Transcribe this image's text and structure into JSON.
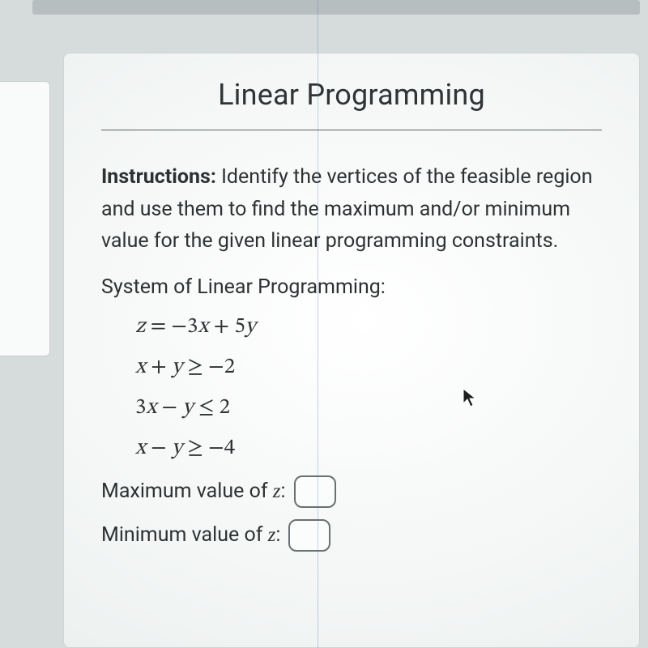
{
  "title": "Linear Programming",
  "instructions_label": "Instructions:",
  "instructions_text": " Identify the vertices of the feasible region and use them to find the maximum and/or minimum value for the given linear programming constraints.",
  "system_label": "System of Linear Programming:",
  "equations": {
    "objective": "z = −3x + 5y",
    "c1": "x + y ≥ −2",
    "c2": "3x − y ≤ 2",
    "c3": "x − y ≥ −4"
  },
  "answers": {
    "max_label_prefix": "Maximum value of ",
    "max_label_var": "z",
    "max_label_suffix": ":",
    "max_value": "",
    "min_label_prefix": "Minimum value of ",
    "min_label_var": "z",
    "min_label_suffix": ":",
    "min_value": ""
  }
}
